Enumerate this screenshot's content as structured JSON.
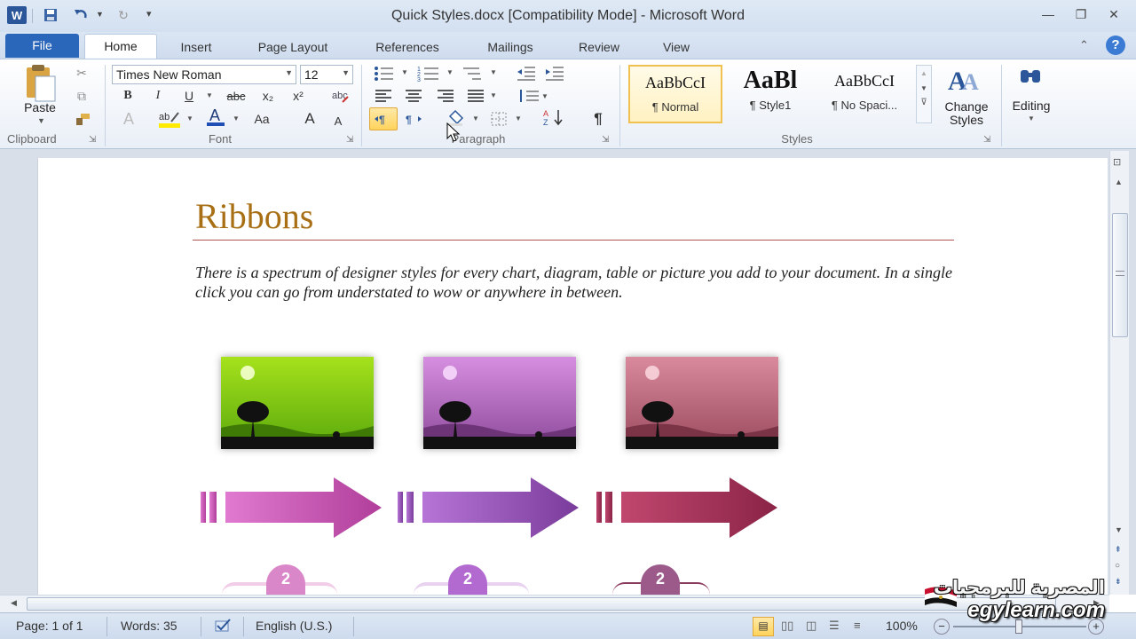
{
  "window": {
    "title": "Quick Styles.docx [Compatibility Mode] - Microsoft Word",
    "app_icon": "W",
    "controls": [
      "minimize",
      "restore",
      "close"
    ]
  },
  "tabs": [
    "File",
    "Home",
    "Insert",
    "Page Layout",
    "References",
    "Mailings",
    "Review",
    "View"
  ],
  "active_tab": "Home",
  "clipboard": {
    "paste_label": "Paste",
    "group_label": "Clipboard"
  },
  "font": {
    "name": "Times New Roman",
    "size": "12",
    "group_label": "Font",
    "buttons": {
      "bold": "B",
      "italic": "I",
      "underline": "U",
      "strike": "abc",
      "subscript": "x₂",
      "superscript": "x²",
      "grow": "A",
      "shrink": "A",
      "case": "Aa"
    }
  },
  "paragraph": {
    "group_label": "Paragraph"
  },
  "styles": {
    "group_label": "Styles",
    "items": [
      {
        "preview": "AaBbCcI",
        "name": "¶ Normal"
      },
      {
        "preview": "AaBl",
        "name": "¶ Style1"
      },
      {
        "preview": "AaBbCcI",
        "name": "¶ No Spaci..."
      }
    ],
    "change_label": "Change Styles"
  },
  "editing": {
    "label": "Editing"
  },
  "document": {
    "heading": "Ribbons",
    "paragraph": "There is a spectrum of designer styles for every chart, diagram, table or picture you add to your document. In a single click you can go from understated to wow or anywhere in between.",
    "circle_labels": [
      "2",
      "2",
      "2"
    ],
    "colors": {
      "heading": "#a86f14",
      "rule": "#b25454"
    }
  },
  "status": {
    "page": "Page: 1 of 1",
    "words": "Words: 35",
    "language": "English (U.S.)",
    "zoom": "100%"
  },
  "watermark": {
    "arabic": "المصرية للبرمجيات",
    "site": "egylearn.com"
  }
}
